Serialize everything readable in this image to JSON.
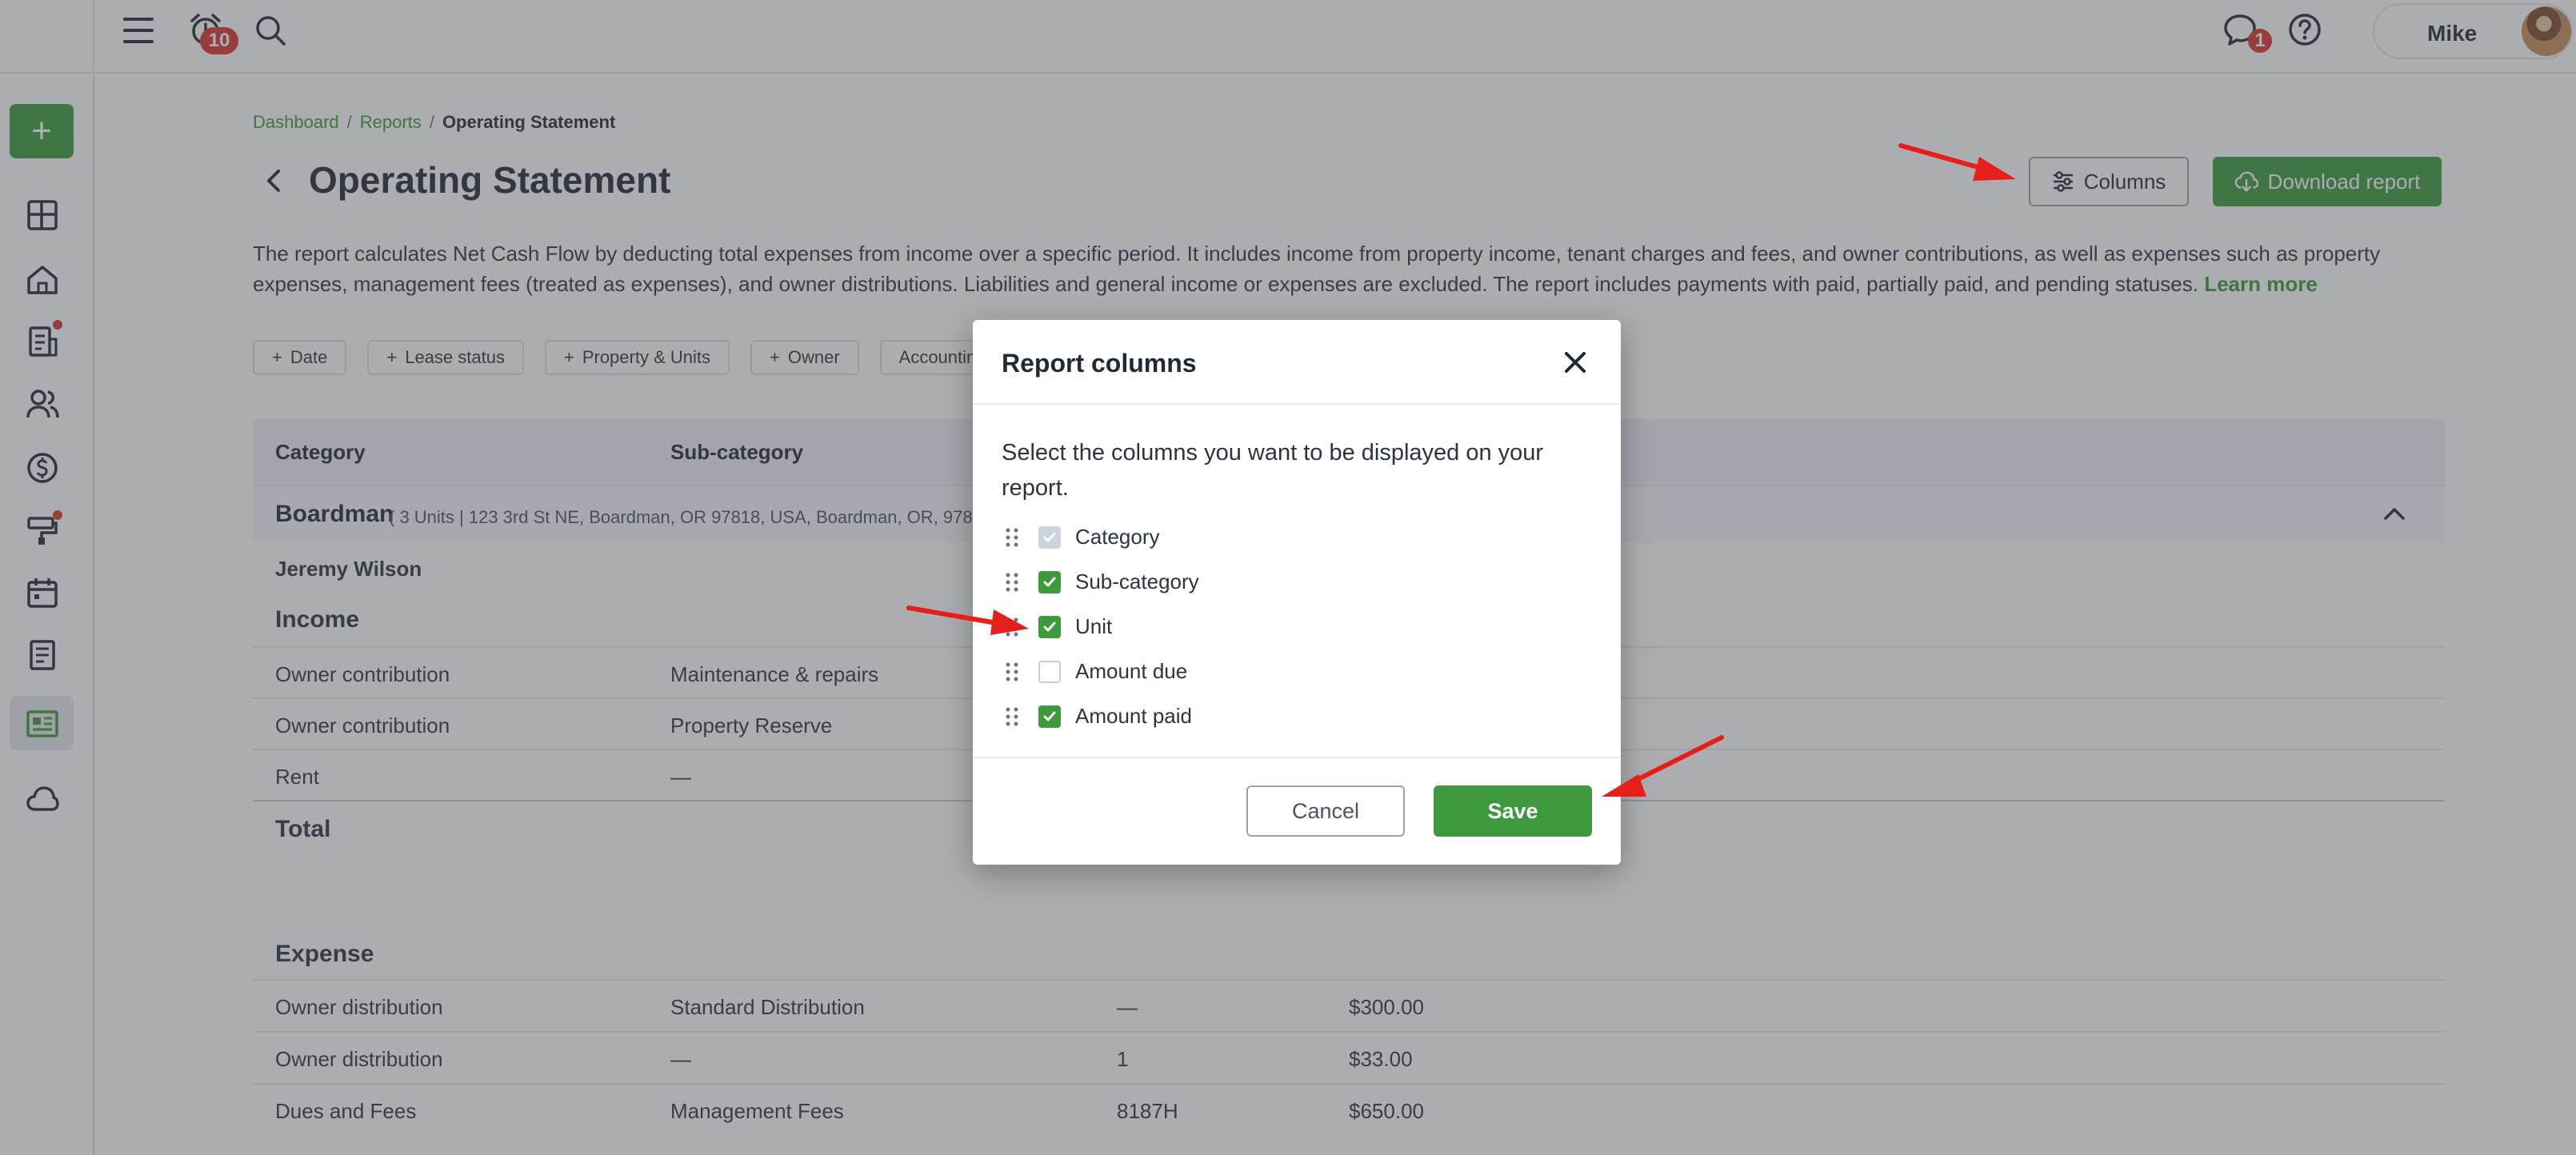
{
  "topbar": {
    "notifications_count": "10",
    "messages_count": "1",
    "user_name": "Mike"
  },
  "breadcrumb": {
    "items": [
      "Dashboard",
      "Reports"
    ],
    "current": "Operating Statement"
  },
  "page": {
    "title": "Operating Statement",
    "columns_button": "Columns",
    "download_button": "Download report",
    "description": "The report calculates Net Cash Flow by deducting total expenses from income over a specific period. It includes income from property income, tenant charges and fees, and owner contributions, as well as expenses such as property expenses, management fees (treated as expenses), and owner distributions. Liabilities and general income or expenses are excluded. The report includes payments with paid, partially paid, and pending statuses.",
    "learn_more": "Learn more"
  },
  "filters": [
    "Date",
    "Lease status",
    "Property & Units",
    "Owner",
    "Accounting t"
  ],
  "table": {
    "headers": [
      "Category",
      "Sub-category"
    ],
    "group": {
      "name": "Boardman",
      "address": "( 3 Units | 123 3rd St NE, Boardman, OR 97818, USA, Boardman, OR, 97818, US"
    },
    "owner": "Jeremy Wilson",
    "income_label": "Income",
    "income_rows": [
      {
        "category": "Owner contribution",
        "sub": "Maintenance & repairs"
      },
      {
        "category": "Owner contribution",
        "sub": "Property Reserve"
      },
      {
        "category": "Rent",
        "sub": "—"
      }
    ],
    "total_label": "Total",
    "expense_label": "Expense",
    "expense_rows": [
      {
        "category": "Owner distribution",
        "sub": "Standard Distribution",
        "unit": "—",
        "amount": "$300.00"
      },
      {
        "category": "Owner distribution",
        "sub": "—",
        "unit": "1",
        "amount": "$33.00"
      },
      {
        "category": "Dues and Fees",
        "sub": "Management Fees",
        "unit": "8187H",
        "amount": "$650.00"
      }
    ]
  },
  "modal": {
    "title": "Report columns",
    "text": "Select the columns you want to be displayed on your report.",
    "columns": [
      {
        "label": "Category",
        "state": "disabled"
      },
      {
        "label": "Sub-category",
        "state": "checked"
      },
      {
        "label": "Unit",
        "state": "checked"
      },
      {
        "label": "Amount due",
        "state": "unchecked"
      },
      {
        "label": "Amount paid",
        "state": "checked"
      }
    ],
    "cancel": "Cancel",
    "save": "Save"
  },
  "colors": {
    "brand_green": "#3c9a3c",
    "badge_red": "#d9342b",
    "annotation_red": "#e5201c"
  }
}
